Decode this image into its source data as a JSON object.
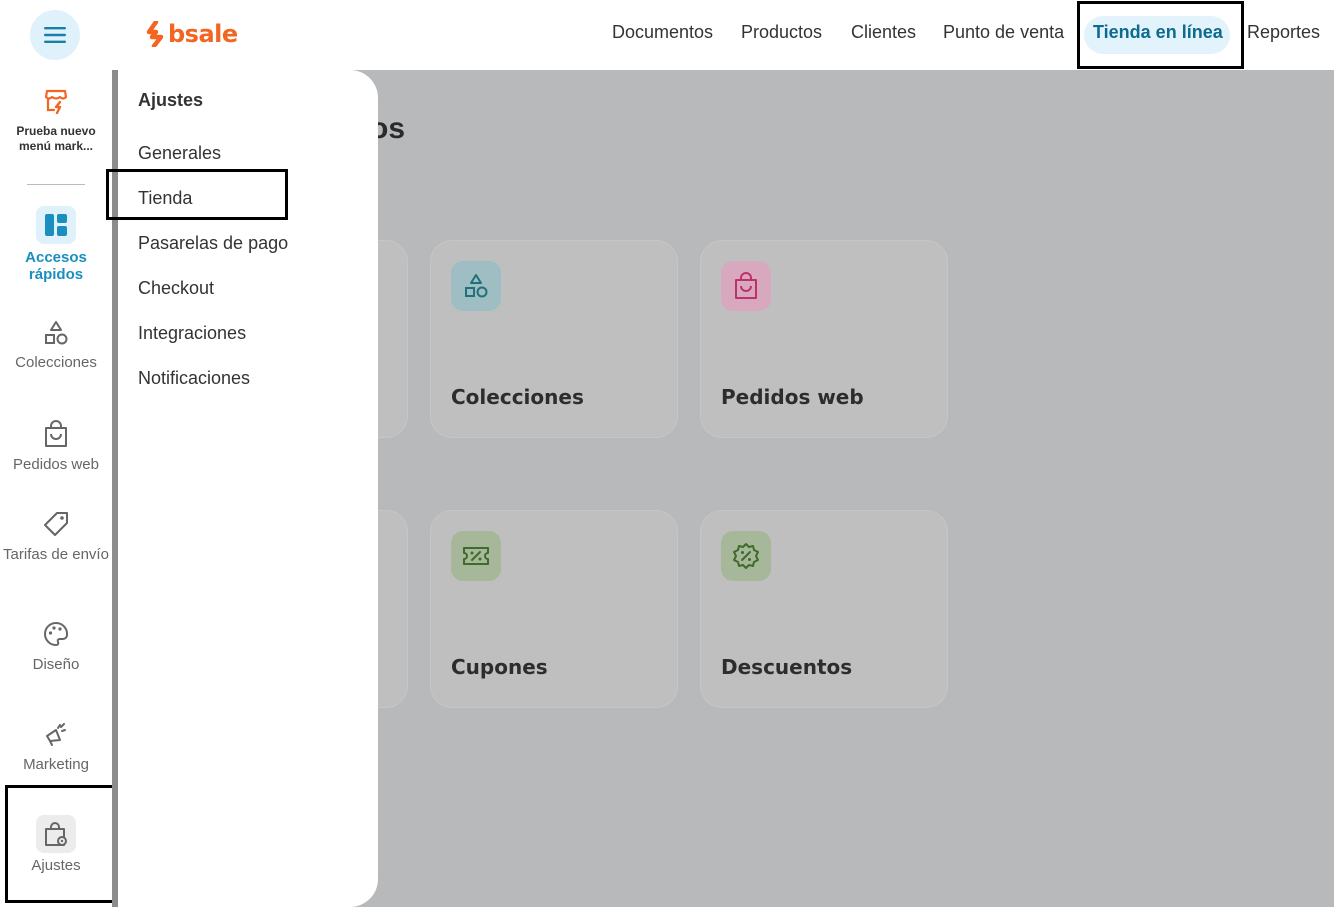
{
  "header": {
    "logo_text": "bsale",
    "nav": [
      "Documentos",
      "Productos",
      "Clientes",
      "Punto de venta",
      "Tienda en línea",
      "Reportes"
    ],
    "active_nav": "Tienda en línea"
  },
  "sidebar": {
    "promo_label": "Prueba nuevo menú mark...",
    "items": [
      {
        "label": "Accesos rápidos",
        "icon": "dashboard-icon",
        "active": true
      },
      {
        "label": "Colecciones",
        "icon": "shapes-icon"
      },
      {
        "label": "Pedidos web",
        "icon": "shopping-bag-icon"
      },
      {
        "label": "Tarifas de envío",
        "icon": "tag-icon"
      },
      {
        "label": "Diseño",
        "icon": "palette-icon"
      },
      {
        "label": "Marketing",
        "icon": "megaphone-icon"
      },
      {
        "label": "Ajustes",
        "icon": "bag-settings-icon"
      }
    ]
  },
  "settings_menu": {
    "title": "Ajustes",
    "items": [
      "Generales",
      "Tienda",
      "Pasarelas de pago",
      "Checkout",
      "Integraciones",
      "Notificaciones"
    ]
  },
  "main": {
    "title_fragment": "os",
    "cards": [
      {
        "label": "Colecciones",
        "icon": "shapes-icon",
        "icon_bg": "#9ebec4",
        "icon_color": "#22707a"
      },
      {
        "label": "Pedidos web",
        "icon": "shopping-bag-icon",
        "icon_bg": "#d7a8be",
        "icon_color": "#c0306b"
      },
      {
        "label": "Cupones",
        "icon": "coupon-icon",
        "icon_bg": "#a6b899",
        "icon_color": "#3f6b2c"
      },
      {
        "label": "Descuentos",
        "icon": "discount-badge-icon",
        "icon_bg": "#a6b899",
        "icon_color": "#3f6b2c"
      }
    ]
  },
  "colors": {
    "brand": "#f26522",
    "accent": "#0d6b8e",
    "overlay": "#b8b9bb"
  }
}
